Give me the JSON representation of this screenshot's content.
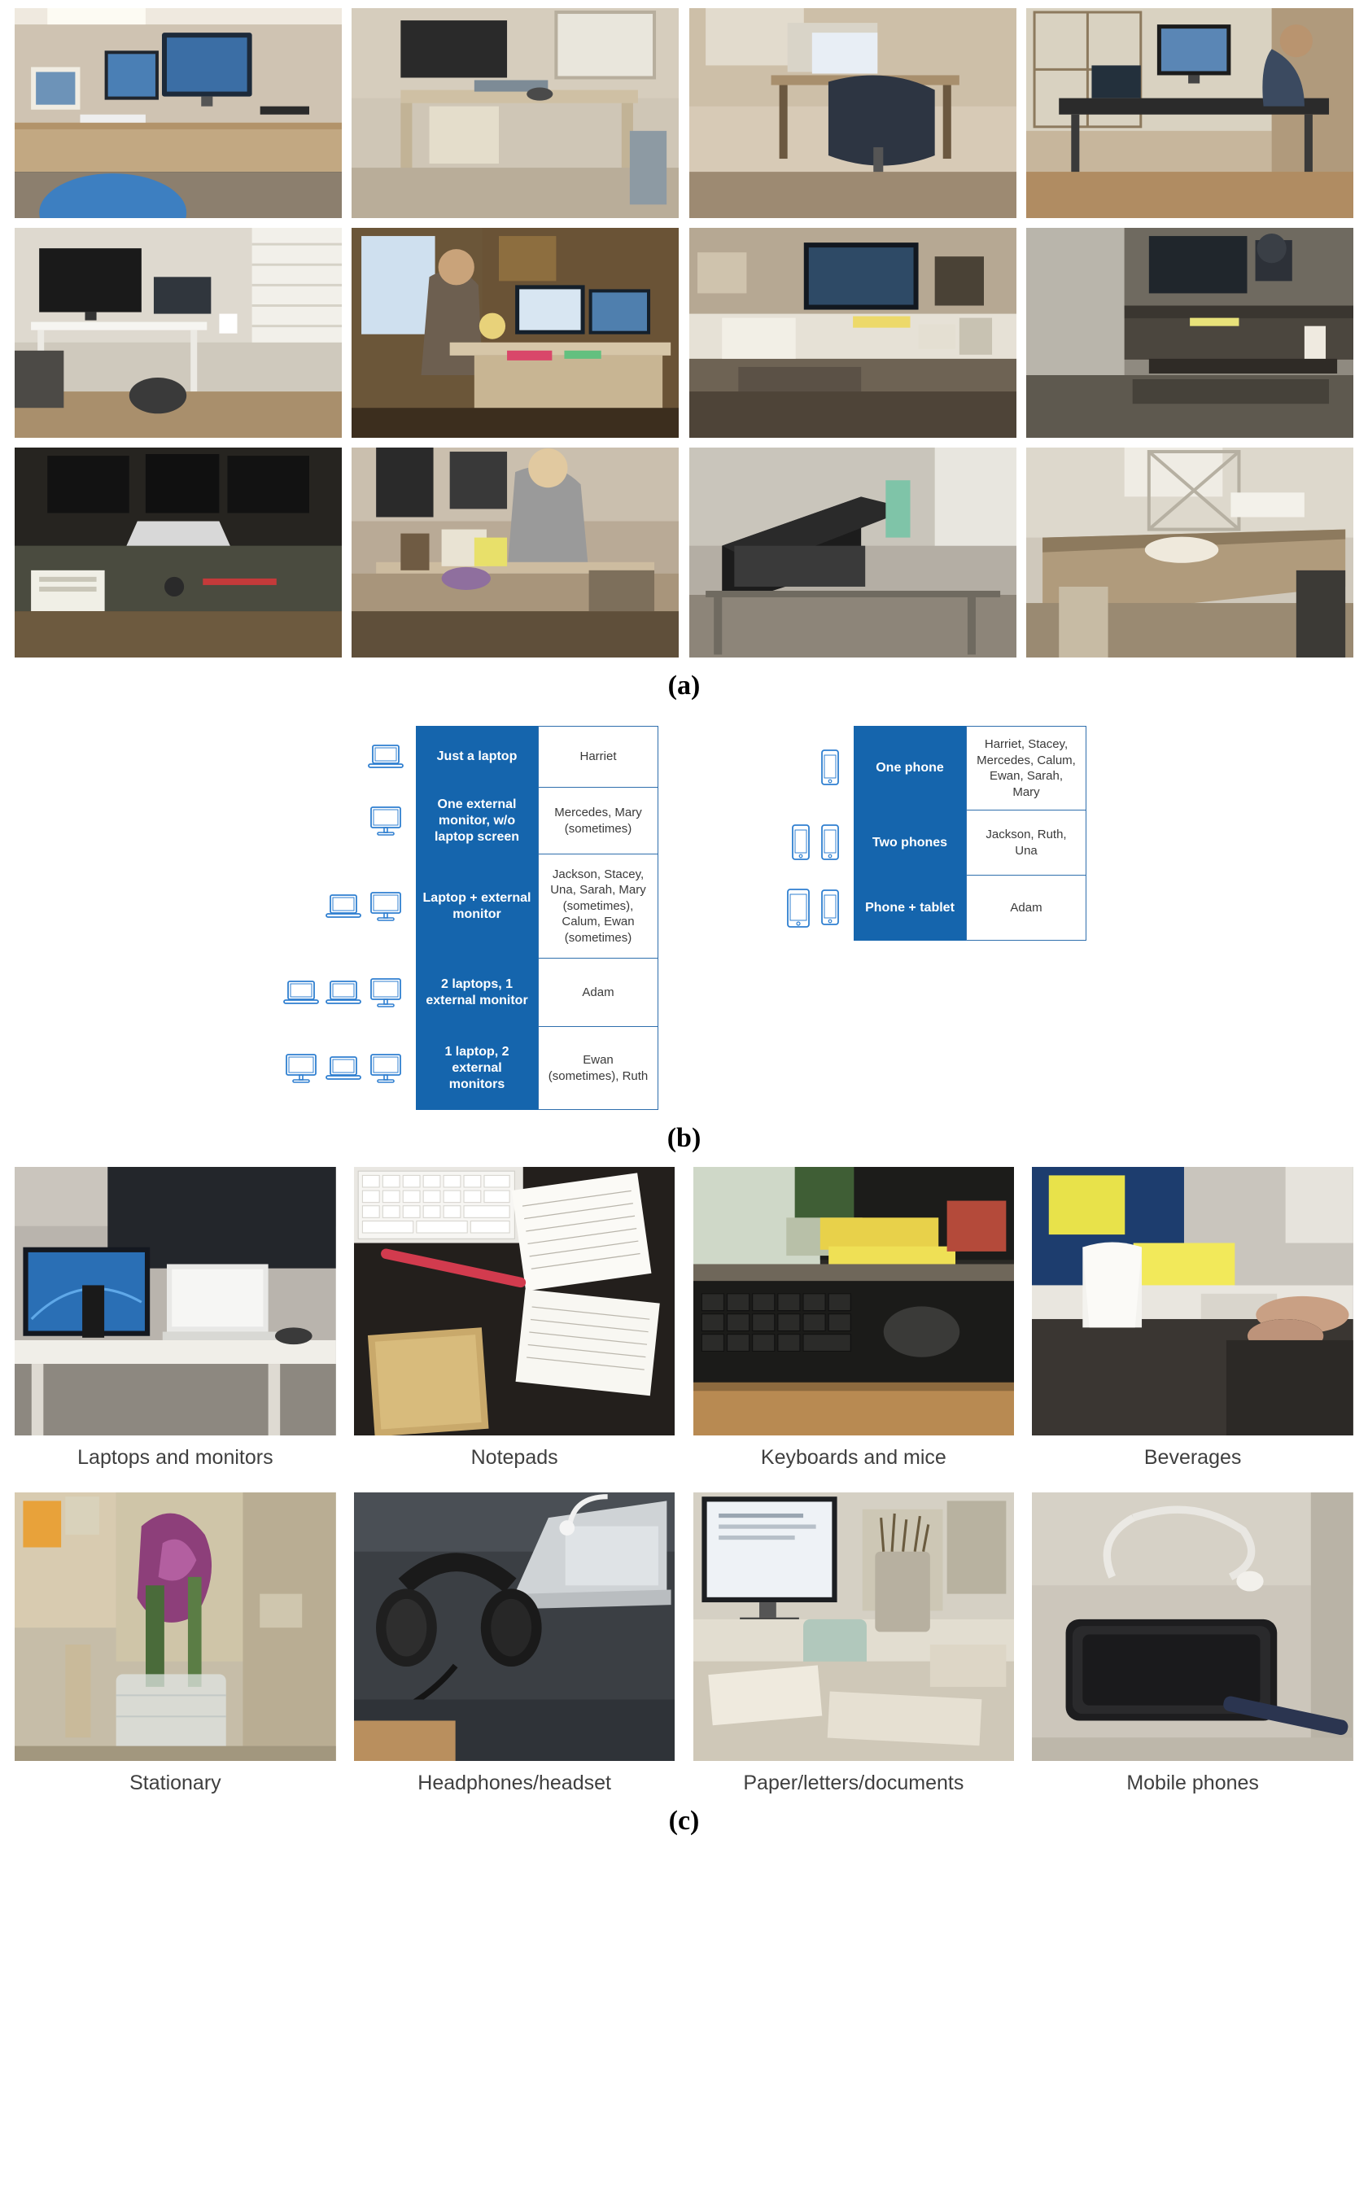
{
  "figure": {
    "panel_a_letter": "(a)",
    "panel_b_letter": "(b)",
    "panel_c_letter": "(c)"
  },
  "panel_a": {
    "images": [
      {
        "alt": "home office desk with two monitors, laptop and exercise ball"
      },
      {
        "alt": "small wooden desk with monitor and chair by window"
      },
      {
        "alt": "desk with laptop on stand and black office chair"
      },
      {
        "alt": "person working at long dark desk with monitor and laptop"
      },
      {
        "alt": "white desk with monitor, laptop and mug near window"
      },
      {
        "alt": "woman working at desk with two monitors in warm-lit room"
      },
      {
        "alt": "cluttered L-shaped white desk with monitor and papers"
      },
      {
        "alt": "standing desk with monitor, lamp and coffee cup"
      },
      {
        "alt": "dark room desk with laptop and two monitors"
      },
      {
        "alt": "woman at shared table with laptop and flowers"
      },
      {
        "alt": "laptop on glass table near window"
      },
      {
        "alt": "granite kitchen counter with plate and stool"
      }
    ]
  },
  "panel_b": {
    "left_table": {
      "rows": [
        {
          "icons": [
            "laptop"
          ],
          "label": "Just a laptop",
          "names": "Harriet"
        },
        {
          "icons": [
            "monitor"
          ],
          "label": "One external monitor, w/o laptop screen",
          "names": "Mercedes, Mary (sometimes)"
        },
        {
          "icons": [
            "laptop",
            "monitor"
          ],
          "label": "Laptop + external monitor",
          "names": "Jackson, Stacey, Una, Sarah, Mary (sometimes), Calum, Ewan (sometimes)"
        },
        {
          "icons": [
            "laptop",
            "laptop",
            "monitor"
          ],
          "label": "2 laptops, 1 external monitor",
          "names": "Adam"
        },
        {
          "icons": [
            "monitor",
            "laptop",
            "monitor"
          ],
          "label": "1 laptop, 2 external monitors",
          "names": "Ewan (sometimes), Ruth"
        }
      ]
    },
    "right_table": {
      "rows": [
        {
          "icons": [
            "phone"
          ],
          "label": "One phone",
          "names": "Harriet, Stacey, Mercedes, Calum, Ewan, Sarah, Mary"
        },
        {
          "icons": [
            "phone",
            "phone"
          ],
          "label": "Two phones",
          "names": "Jackson,  Ruth, Una"
        },
        {
          "icons": [
            "tablet",
            "phone"
          ],
          "label": "Phone + tablet",
          "names": "Adam"
        }
      ]
    },
    "accent_color": "#1565ad",
    "border_color": "#2f6fad"
  },
  "panel_c": {
    "items": [
      {
        "caption": "Laptops and monitors",
        "alt": "monitor and laptop on white desk with blue wallpaper"
      },
      {
        "caption": "Notepads",
        "alt": "keyboard, pen, notepad and papers on dark desk"
      },
      {
        "caption": "Keyboards and mice",
        "alt": "keyboard, mouse and yellow notebooks on desk"
      },
      {
        "caption": "Beverages",
        "alt": "paper cup and hands typing on desk"
      },
      {
        "caption": "Stationary",
        "alt": "glass jar of pens and flowers on desk"
      },
      {
        "caption": "Headphones/headset",
        "alt": "headphones and laptop on dark desk"
      },
      {
        "caption": "Paper/letters/documents",
        "alt": "desk with monitor, papers and pen holder"
      },
      {
        "caption": "Mobile phones",
        "alt": "black mobile phone with white cable on desk"
      }
    ]
  }
}
